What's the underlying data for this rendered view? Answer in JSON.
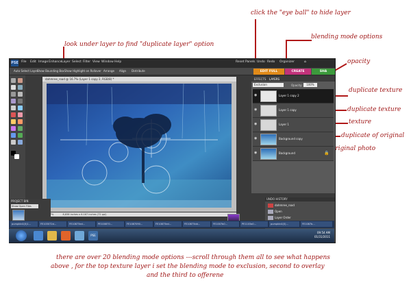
{
  "annotations": {
    "duplicate_layer": "look under layer to find \"duplicate layer\" option",
    "eye_ball": "click  the \"eye ball\" to hide layer",
    "blending_mode": "blending mode options",
    "opacity": "opacity",
    "dup_texture_1": "duplicate texture",
    "dup_texture_2": "duplicate texture",
    "texture": "texture",
    "dup_original": "duplicate of original",
    "original_photo": "original photo",
    "bottom_line1": "there are over 20 blending mode options ---scroll through them all to see what happens",
    "bottom_line2": "above , for the top texture layer i set the blending mode to exclusion, second to overlay",
    "bottom_line3": "and the third to offerene"
  },
  "app": {
    "logo": "PSE",
    "menu": [
      "File",
      "Edit",
      "Image",
      "Enhance",
      "Layer",
      "Select",
      "Filter",
      "View",
      "Window",
      "Help"
    ],
    "top_right": [
      "Reset Panels",
      "Undo",
      "Redo",
      "Organizer"
    ],
    "options": [
      "Auto Select Layer",
      "Show Bounding Box",
      "Show Highlight on Rollover",
      "Arrange",
      "Align",
      "Distribute"
    ],
    "mode_tabs": [
      "EDIT FULL",
      "CREATE",
      "SHA"
    ],
    "mode_colors": [
      "#e08a1a",
      "#c1327a",
      "#3c9a3c"
    ],
    "doc_tab": "dahmree_road @ 16.7% (Layer 1 copy 2, RGB/8) *",
    "status": "16.67%",
    "status_detail": "8,838 inches x 6.167 inches (72 ppi)",
    "project_bin": "PROJECT BIN",
    "show_open": "Show Open Files",
    "panel_tabs": [
      "EFFECTS",
      "LAYERS"
    ],
    "blend_mode": "Exclusion",
    "opacity_label": "Opacity:",
    "opacity_value": "100%",
    "layers": [
      {
        "name": "Layer 1 copy 2",
        "selected": true
      },
      {
        "name": "Layer 1 copy",
        "selected": false
      },
      {
        "name": "Layer 1",
        "selected": false
      },
      {
        "name": "Background copy",
        "selected": false
      },
      {
        "name": "Background",
        "selected": false,
        "locked": true
      }
    ],
    "undo_title": "UNDO HISTORY",
    "undo_items": [
      "dahmree_road",
      "Open",
      "Layer Order",
      "Layer Order"
    ],
    "taskbar_items": [
      "pumpkin4(0)1...",
      "FE103072d...",
      "FE10873ed...",
      "PE100870...",
      "FE1087090...",
      "FE10873ed...",
      "FE10873dd...",
      "FE1007b0...",
      "PE1103a0...",
      "pumpkin4(0)...",
      "FE1087b..."
    ],
    "clock_time": "09:54 AM",
    "clock_date": "01/31/2011"
  }
}
